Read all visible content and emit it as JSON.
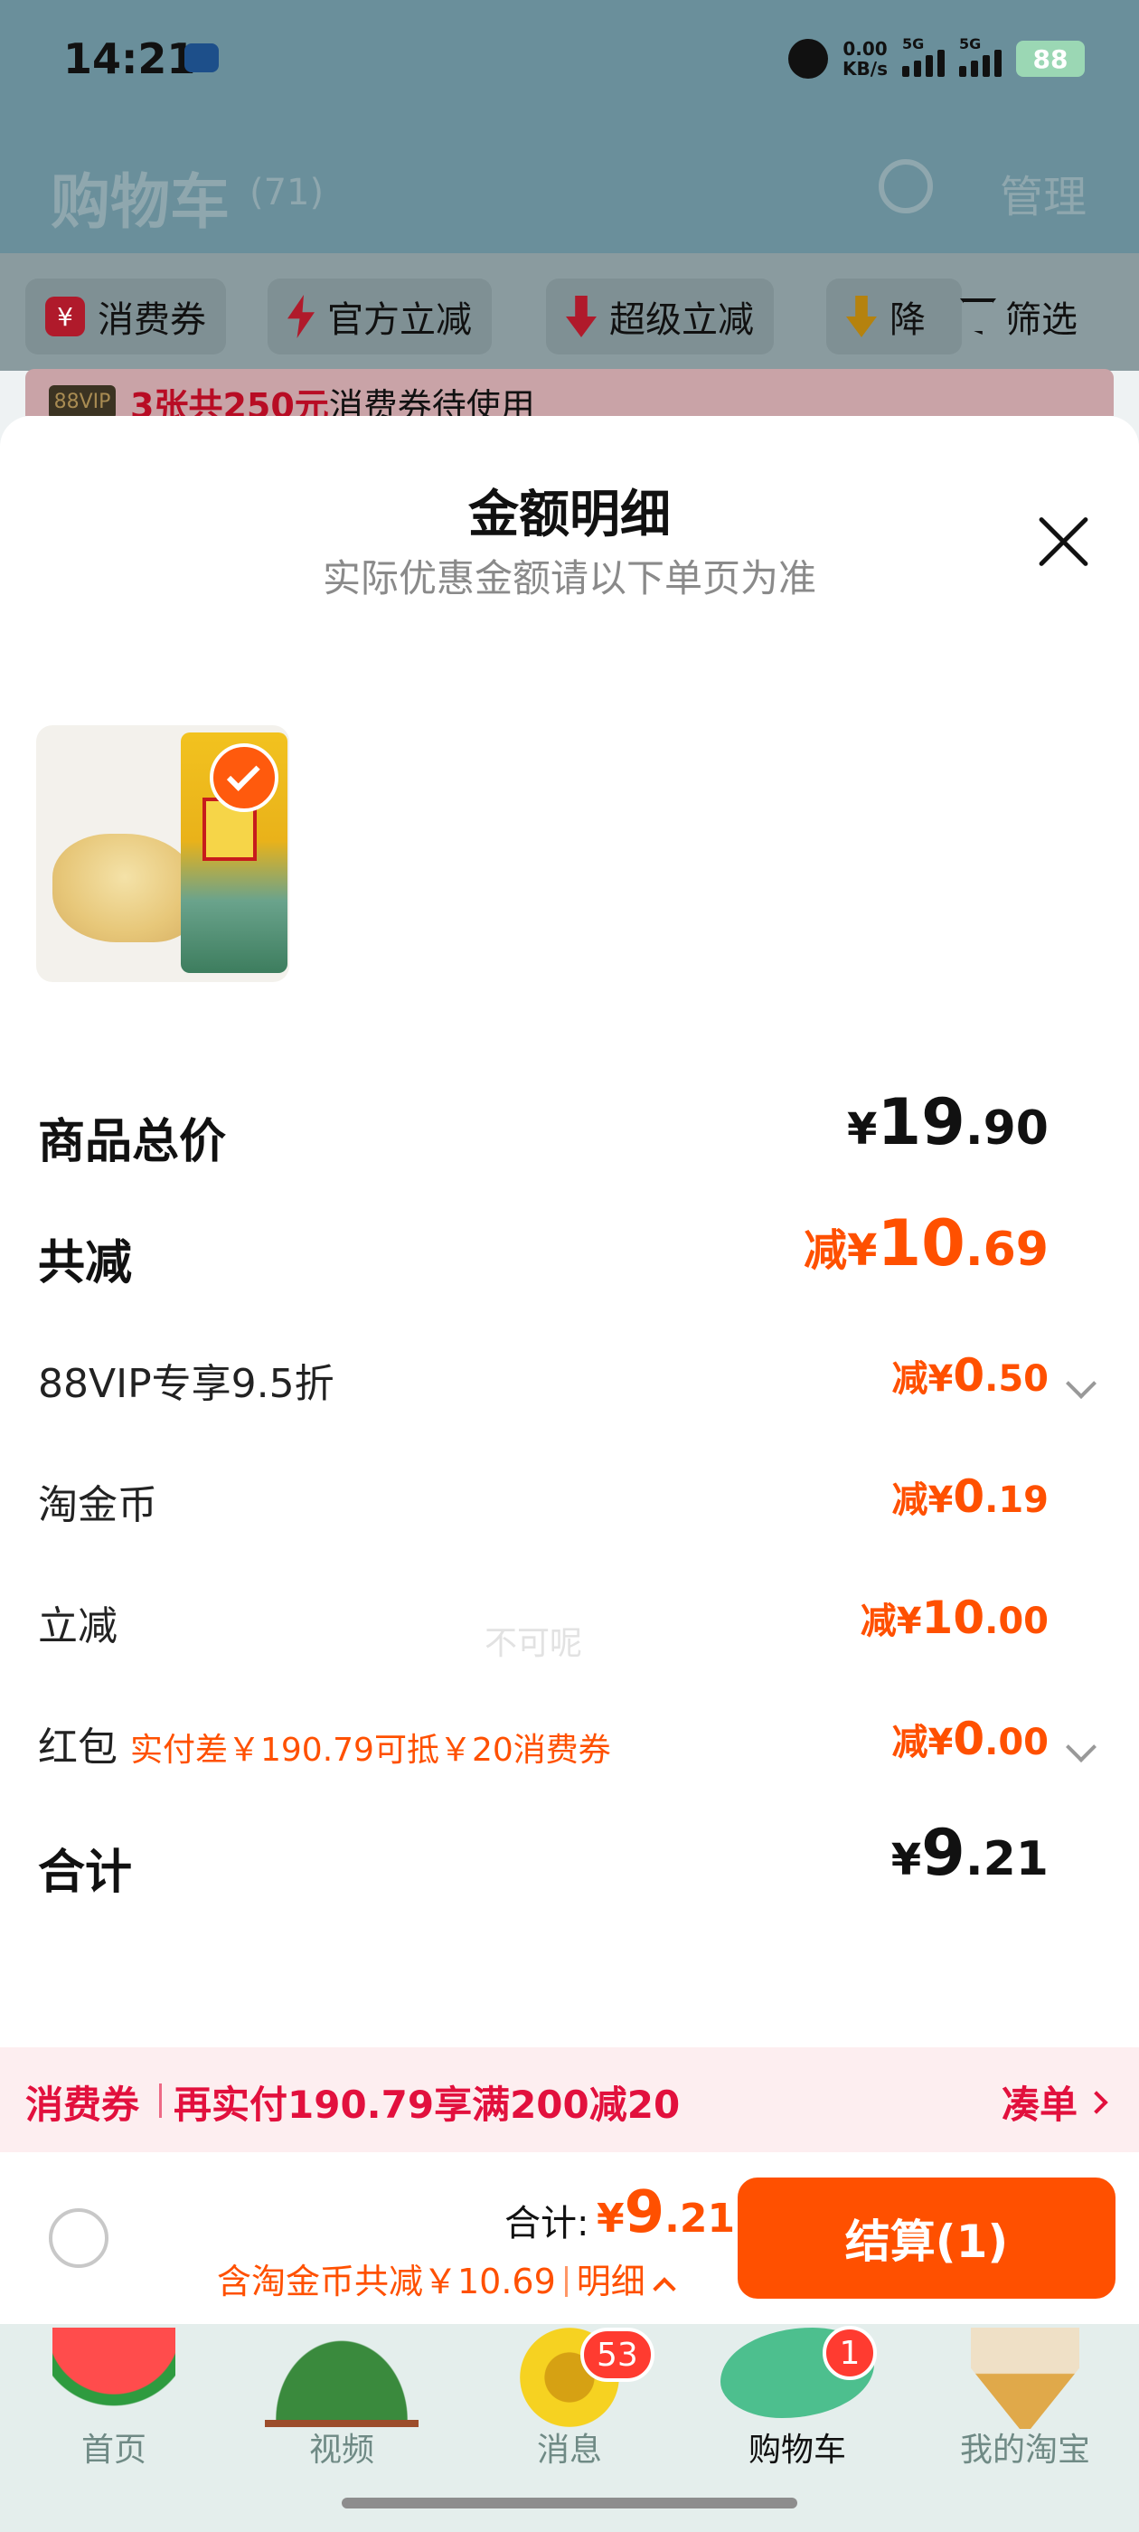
{
  "status_bar": {
    "time": "14:21",
    "net_speed_value": "0.00",
    "net_speed_unit": "KB/s",
    "sim1_tag": "5G",
    "sim2_tag": "5G",
    "battery": "88"
  },
  "cart_header": {
    "title": "购物车",
    "count": "(71)",
    "manage_label": "管理"
  },
  "filters": {
    "chips": [
      "消费券",
      "官方立减",
      "超级立减",
      "降"
    ],
    "coupon_icon": "¥",
    "filter_label": "筛选"
  },
  "vip_strip": {
    "badge": "88VIP",
    "highlight": "3张共250元",
    "text": "消费券待使用"
  },
  "sheet": {
    "title": "金额明细",
    "subtitle": "实际优惠金额请以下单页为准",
    "watermark": "不可呢",
    "rows": {
      "total_price": {
        "label": "商品总价",
        "currency": "¥",
        "integer": "19",
        "decimal": ".90"
      },
      "total_discount": {
        "label": "共减",
        "prefix": "减¥",
        "integer": "10",
        "decimal": ".69"
      },
      "vip": {
        "label": "88VIP专享9.5折",
        "prefix": "减¥",
        "integer": "0",
        "decimal": ".50"
      },
      "coin": {
        "label": "淘金币",
        "prefix": "减¥",
        "integer": "0",
        "decimal": ".19"
      },
      "instant": {
        "label": "立减",
        "prefix": "减¥",
        "integer": "10",
        "decimal": ".00"
      },
      "hongbao": {
        "label": "红包",
        "note": "实付差￥190.79可抵￥20消费券",
        "prefix": "减¥",
        "integer": "0",
        "decimal": ".00"
      },
      "sum": {
        "label": "合计",
        "currency": "¥",
        "integer": "9",
        "decimal": ".21"
      }
    }
  },
  "coupon_bar": {
    "tag": "消费券",
    "text": "再实付190.79享满200减20",
    "link": "凑单"
  },
  "checkout": {
    "total_label": "合计:",
    "currency": "¥",
    "integer": "9",
    "decimal": ".21",
    "discount_note": "含淘金币共减￥10.69",
    "detail_label": "明细",
    "settle_label": "结算(1)"
  },
  "tabbar": {
    "items": [
      {
        "label": "首页",
        "icon": "watermelon-icon"
      },
      {
        "label": "视频",
        "icon": "fan-icon"
      },
      {
        "label": "消息",
        "icon": "sunflower-icon",
        "badge": "53"
      },
      {
        "label": "购物车",
        "icon": "leaf-cart-icon",
        "badge": "1"
      },
      {
        "label": "我的淘宝",
        "icon": "ice-cream-icon"
      }
    ]
  },
  "colors": {
    "accent": "#ff5000",
    "coupon_red": "#e2103d",
    "dim_header": "#6a8f9b"
  }
}
